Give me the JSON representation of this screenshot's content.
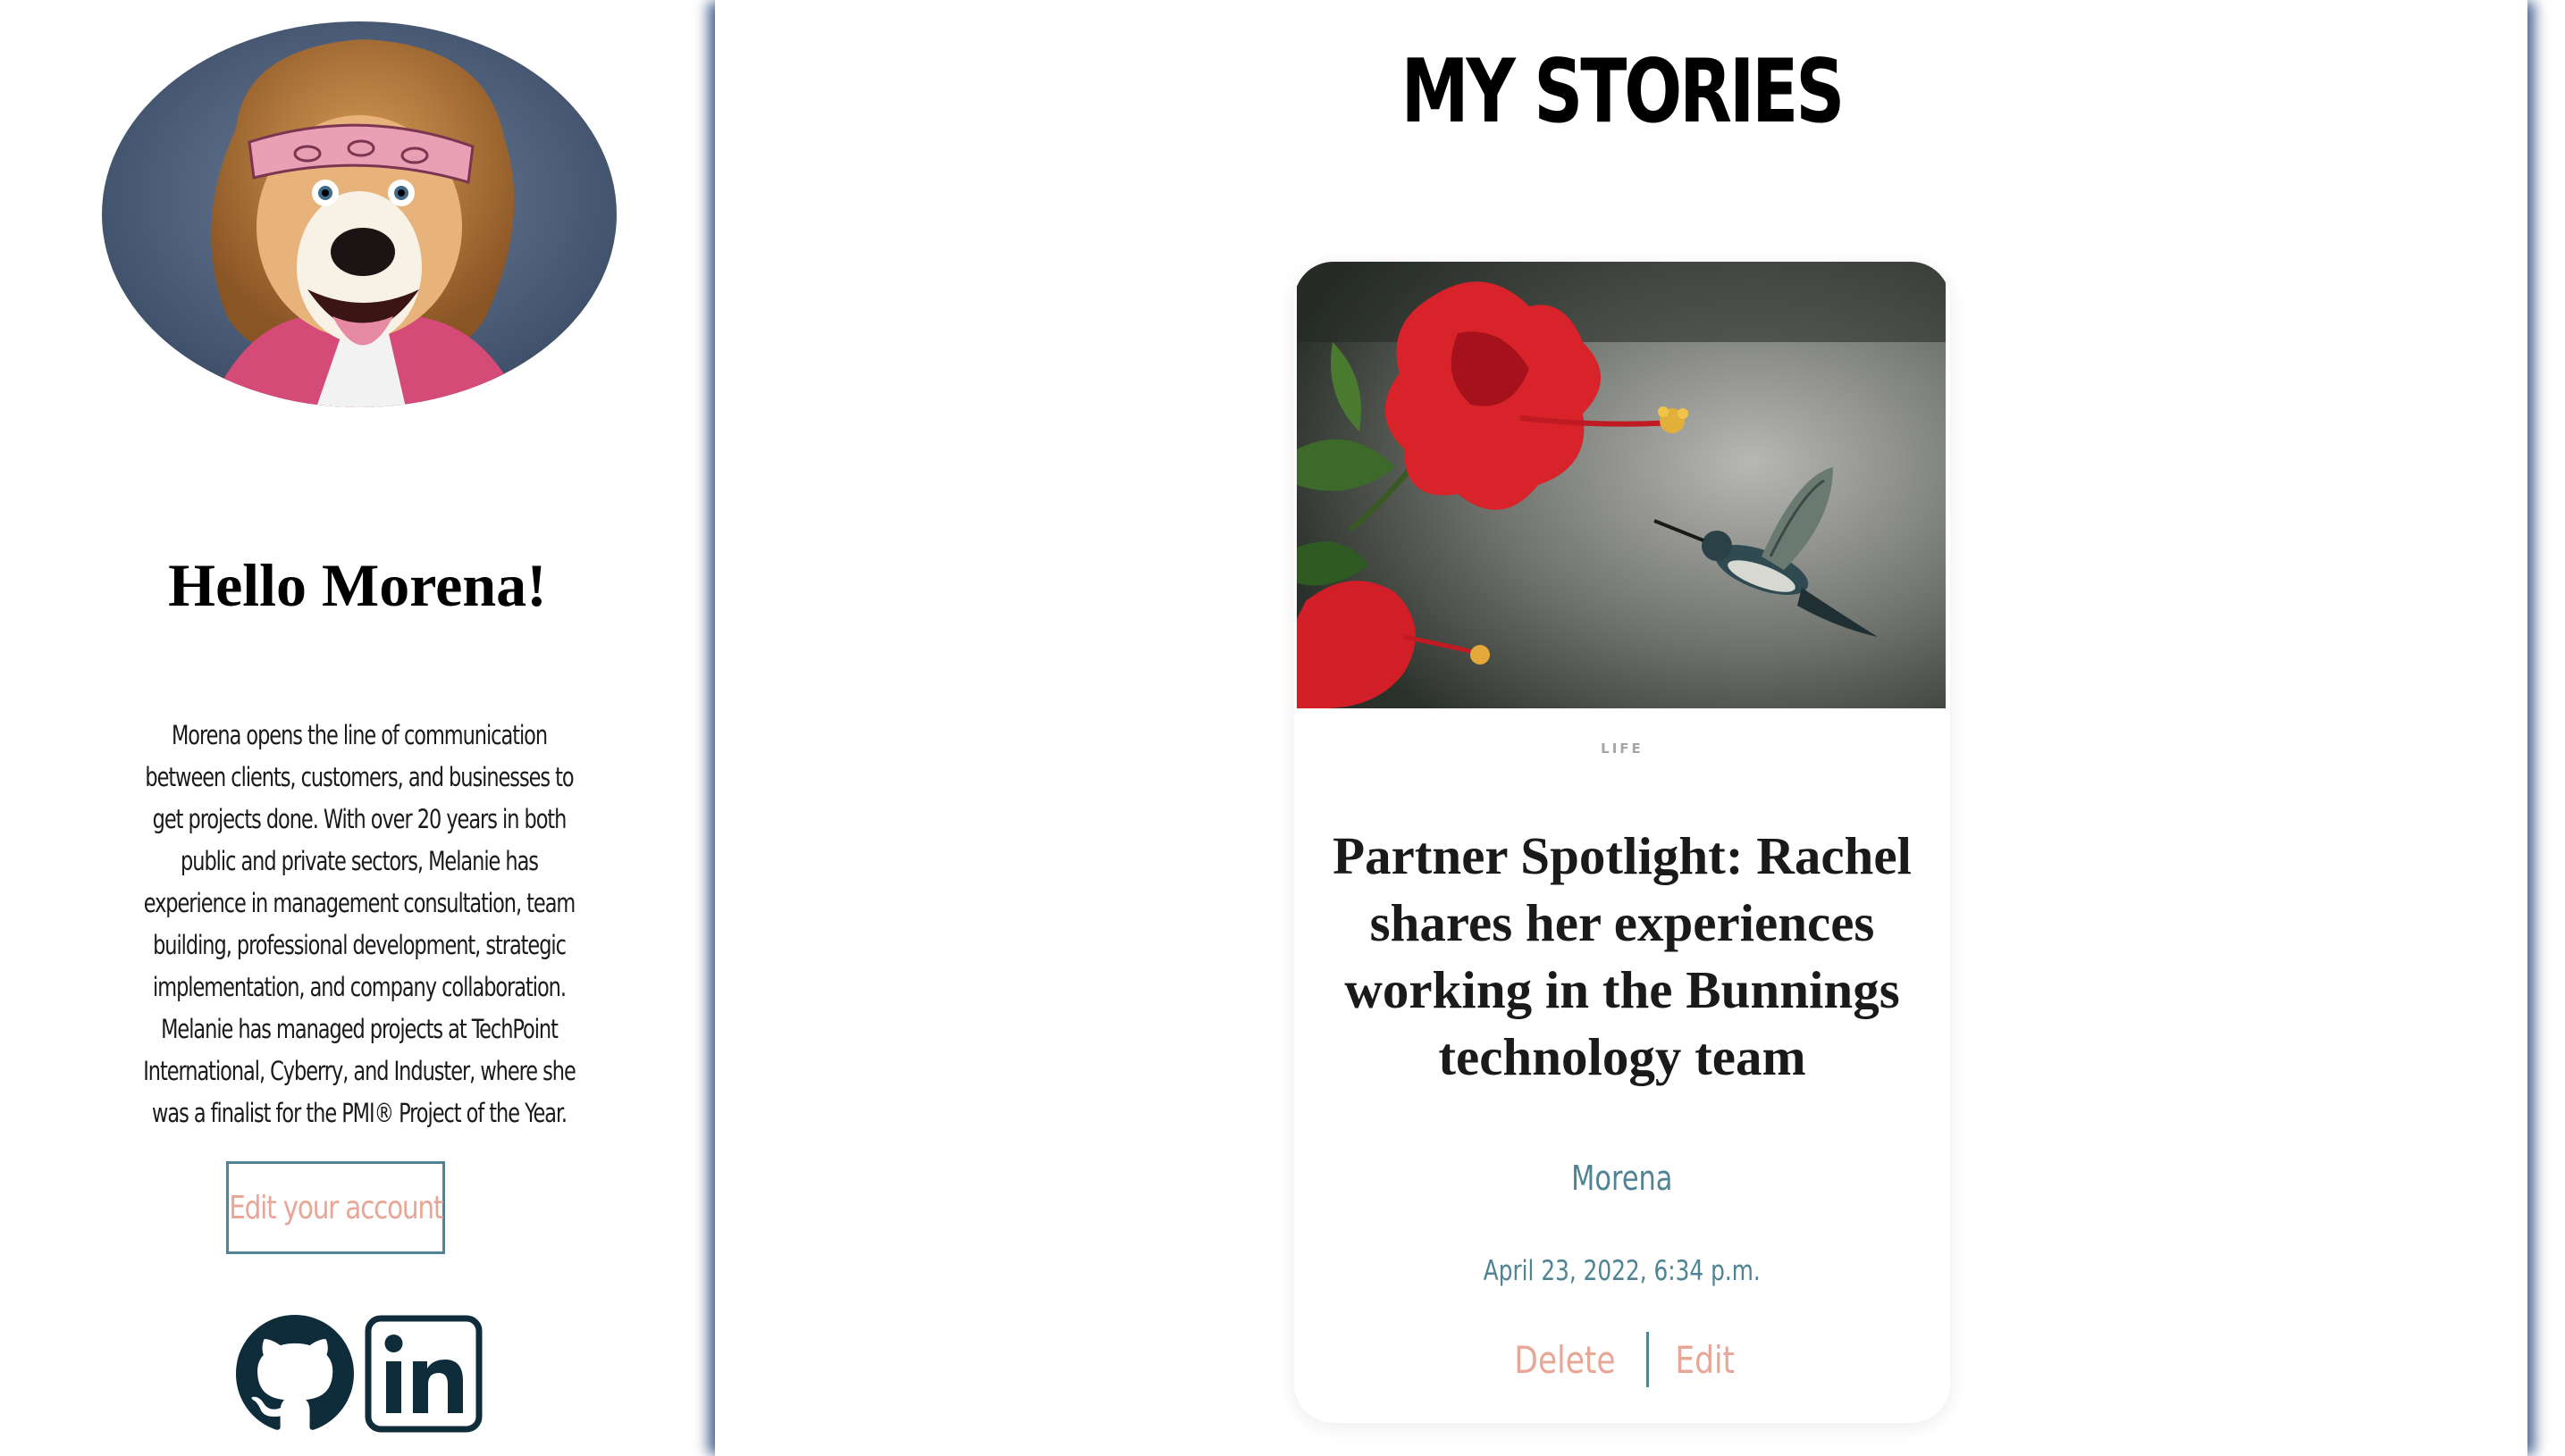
{
  "sidebar": {
    "greeting": "Hello Morena!",
    "bio": "Morena opens the line of communication between clients, customers, and businesses to get projects done. With over 20 years in both public and private sectors, Melanie has experience in management consultation, team building, professional development, strategic implementation, and company collaboration. Melanie has managed projects at TechPoint International, Cyberry, and Induster, where she was a finalist for the PMI® Project of the Year.",
    "edit_account_label": "Edit your account",
    "social": [
      {
        "name": "github-icon"
      },
      {
        "name": "linkedin-icon"
      }
    ]
  },
  "main": {
    "title": "MY STORIES",
    "stories": [
      {
        "category": "LIFE",
        "title": "Partner Spotlight: Rachel shares her experiences working in the Bunnings technology team",
        "author": "Morena",
        "date": "April 23, 2022, 6:34 p.m.",
        "delete_label": "Delete",
        "edit_label": "Edit"
      }
    ]
  },
  "colors": {
    "accent_teal": "#4f8494",
    "accent_salmon": "#e8a796",
    "panel_shadow": "#325082",
    "icon_dark": "#0f2c3a"
  }
}
